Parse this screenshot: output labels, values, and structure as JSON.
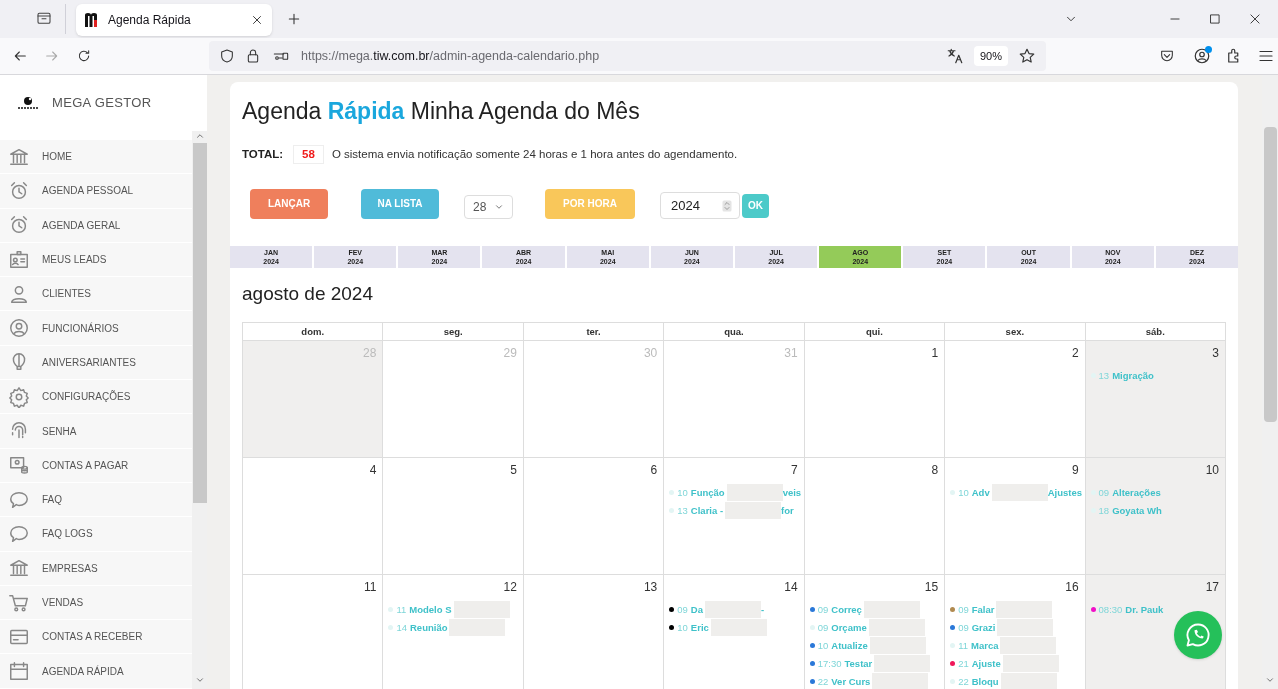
{
  "browser": {
    "tabs": [
      {
        "title": "Agenda Rápida",
        "selected": true
      }
    ],
    "url": {
      "scheme": "https://mega.",
      "domain": "tiw.com.br",
      "path": "/admin-agenda-calendario.php"
    },
    "zoom": "90%"
  },
  "sidebar": {
    "brand": "MEGA GESTOR",
    "items": [
      {
        "label": "HOME"
      },
      {
        "label": "AGENDA PESSOAL"
      },
      {
        "label": "AGENDA GERAL"
      },
      {
        "label": "MEUS LEADS"
      },
      {
        "label": "CLIENTES"
      },
      {
        "label": "FUNCIONÁRIOS"
      },
      {
        "label": "ANIVERSARIANTES"
      },
      {
        "label": "CONFIGURAÇÕES"
      },
      {
        "label": "SENHA"
      },
      {
        "label": "CONTAS A PAGAR"
      },
      {
        "label": "FAQ"
      },
      {
        "label": "FAQ LOGS"
      },
      {
        "label": "EMPRESAS"
      },
      {
        "label": "VENDAS"
      },
      {
        "label": "CONTAS A RECEBER"
      },
      {
        "label": "AGENDA RÁPIDA"
      }
    ]
  },
  "page": {
    "title": "Agenda **Rápida** Minha Agenda do Mês",
    "total_label": "TOTAL:",
    "total": "58",
    "notice": "O sistema envia notificação somente 24 horas e 1 hora antes do agendamento.",
    "buttons": [
      {
        "label": "LANÇAR",
        "kind": "orange"
      },
      {
        "label": "NA LISTA",
        "kind": "blue"
      }
    ],
    "day_select": "28",
    "hour_button": "POR HORA",
    "year": "2024",
    "ok": "OK"
  },
  "months": [
    {
      "label": "JAN",
      "year": "2024",
      "selected": false
    },
    {
      "label": "FEV",
      "year": "2024",
      "selected": false
    },
    {
      "label": "MAR",
      "year": "2024",
      "selected": false
    },
    {
      "label": "ABR",
      "year": "2024",
      "selected": false
    },
    {
      "label": "MAI",
      "year": "2024",
      "selected": false
    },
    {
      "label": "JUN",
      "year": "2024",
      "selected": false
    },
    {
      "label": "JUL",
      "year": "2024",
      "selected": false
    },
    {
      "label": "AGO",
      "year": "2024",
      "selected": true
    },
    {
      "label": "SET",
      "year": "2024",
      "selected": false
    },
    {
      "label": "OUT",
      "year": "2024",
      "selected": false
    },
    {
      "label": "NOV",
      "year": "2024",
      "selected": false
    },
    {
      "label": "DEZ",
      "year": "2024",
      "selected": false
    }
  ],
  "calendar": {
    "title": "agosto de 2024",
    "weekdays": [
      "dom.",
      "seg.",
      "ter.",
      "qua.",
      "qui.",
      "sex.",
      "sáb."
    ],
    "weeks": [
      [
        {
          "day": "28",
          "other_month": true,
          "shaded": true
        },
        {
          "day": "29",
          "other_month": true,
          "shaded": false
        },
        {
          "day": "30",
          "other_month": true,
          "shaded": false
        },
        {
          "day": "31",
          "other_month": true,
          "shaded": false
        },
        {
          "day": "1",
          "other_month": false,
          "shaded": false
        },
        {
          "day": "2",
          "other_month": false,
          "shaded": false
        },
        {
          "day": "3",
          "other_month": false,
          "shaded": true,
          "events": [
            {
              "time": "13",
              "title": "Migração",
              "color": "#e3f5f4",
              "redacted": false
            }
          ]
        }
      ],
      [
        {
          "day": "4",
          "other_month": false,
          "shaded": false
        },
        {
          "day": "5",
          "other_month": false,
          "shaded": false
        },
        {
          "day": "6",
          "other_month": false,
          "shaded": false
        },
        {
          "day": "7",
          "other_month": false,
          "shaded": false,
          "events": [
            {
              "time": "10",
              "title": "Função",
              "tail": "veis",
              "color": "#e3f5f4",
              "redacted": true
            },
            {
              "time": "13",
              "title": "Claria -",
              "tail": "for",
              "color": "#e3f5f4",
              "redacted": true
            }
          ]
        },
        {
          "day": "8",
          "other_month": false,
          "shaded": false
        },
        {
          "day": "9",
          "other_month": false,
          "shaded": false,
          "events": [
            {
              "time": "10",
              "title": "Adv",
              "tail": "Ajustes",
              "color": "#e3f5f4",
              "redacted": true
            }
          ]
        },
        {
          "day": "10",
          "other_month": false,
          "shaded": true,
          "events": [
            {
              "time": "09",
              "title": "Alterações",
              "color": "#e3f5f4",
              "redacted": false
            },
            {
              "time": "18",
              "title": "Goyata Wh",
              "color": "#e3f5f4",
              "redacted": false
            }
          ]
        }
      ],
      [
        {
          "day": "11",
          "other_month": false,
          "shaded": false
        },
        {
          "day": "12",
          "other_month": false,
          "shaded": false,
          "events": [
            {
              "time": "11",
              "title": "Modelo S",
              "color": "#e3f5f4",
              "redacted": true
            },
            {
              "time": "14",
              "title": "Reunião",
              "color": "#e3f5f4",
              "redacted": true
            }
          ]
        },
        {
          "day": "13",
          "other_month": false,
          "shaded": false
        },
        {
          "day": "14",
          "other_month": false,
          "shaded": false,
          "events": [
            {
              "time": "09",
              "title": "Da",
              "tail": "-",
              "color": "#000000",
              "redacted": true
            },
            {
              "time": "10",
              "title": "Eric",
              "color": "#000000",
              "redacted": true
            }
          ]
        },
        {
          "day": "15",
          "other_month": false,
          "shaded": false,
          "events": [
            {
              "time": "09",
              "title": "Correç",
              "color": "#2a78d8",
              "redacted": true
            },
            {
              "time": "09",
              "title": "Orçame",
              "color": "#e3f5f4",
              "redacted": true
            },
            {
              "time": "10",
              "title": "Atualize",
              "color": "#2a78d8",
              "redacted": true
            },
            {
              "time": "17:30",
              "title": "Testar",
              "color": "#2a78d8",
              "redacted": true
            },
            {
              "time": "22",
              "title": "Ver Curs",
              "color": "#2a78d8",
              "redacted": true
            }
          ]
        },
        {
          "day": "16",
          "other_month": false,
          "shaded": false,
          "events": [
            {
              "time": "09",
              "title": "Falar",
              "color": "#b08a50",
              "redacted": true
            },
            {
              "time": "09",
              "title": "Grazi",
              "color": "#2a78d8",
              "redacted": true
            },
            {
              "time": "11",
              "title": "Marca",
              "color": "#e3f5f4",
              "redacted": true
            },
            {
              "time": "21",
              "title": "Ajuste",
              "color": "#f0185a",
              "redacted": true
            },
            {
              "time": "22",
              "title": "Bloqu",
              "color": "#e3f5f4",
              "redacted": true
            }
          ]
        },
        {
          "day": "17",
          "other_month": false,
          "shaded": true,
          "events": [
            {
              "time": "08:30",
              "title": "Dr. Pauk",
              "color": "#f010c8",
              "redacted": false
            }
          ]
        }
      ]
    ]
  }
}
